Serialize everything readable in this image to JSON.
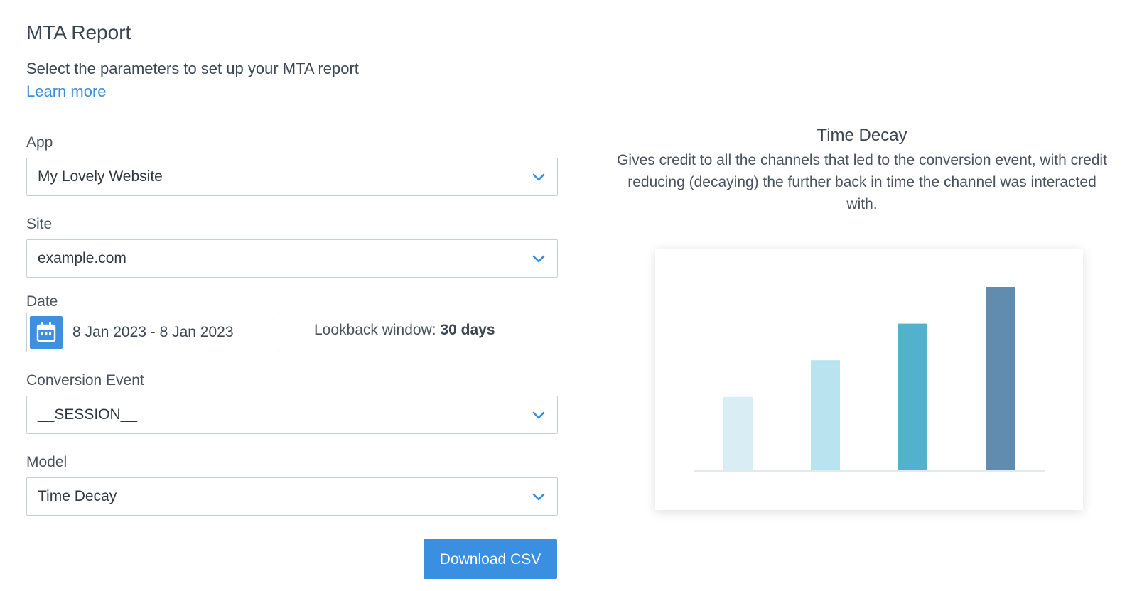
{
  "header": {
    "title": "MTA Report",
    "subtitle": "Select the parameters to set up your MTA report",
    "learn_more": "Learn more"
  },
  "form": {
    "app": {
      "label": "App",
      "value": "My Lovely Website"
    },
    "site": {
      "label": "Site",
      "value": "example.com"
    },
    "date": {
      "label": "Date",
      "value": "8 Jan 2023 - 8 Jan 2023",
      "lookback_label": "Lookback window:",
      "lookback_value": "30 days"
    },
    "conversion_event": {
      "label": "Conversion Event",
      "value": "__SESSION__"
    },
    "model": {
      "label": "Model",
      "value": "Time Decay"
    },
    "download_label": "Download CSV"
  },
  "model_info": {
    "title": "Time Decay",
    "description": "Gives credit to all the channels that led to the conversion event, with credit reducing (decaying) the further back in time the channel was interacted with."
  },
  "colors": {
    "accent": "#3a8fe0",
    "link": "#3a8fdd"
  },
  "chart_data": {
    "type": "bar",
    "title": "",
    "xlabel": "",
    "ylabel": "",
    "ylim": [
      0,
      1
    ],
    "values": [
      0.4,
      0.6,
      0.8,
      1.0
    ],
    "colors": [
      "#d9edf4",
      "#b8e3ef",
      "#52b1cb",
      "#5f8caf"
    ],
    "grid": false
  }
}
